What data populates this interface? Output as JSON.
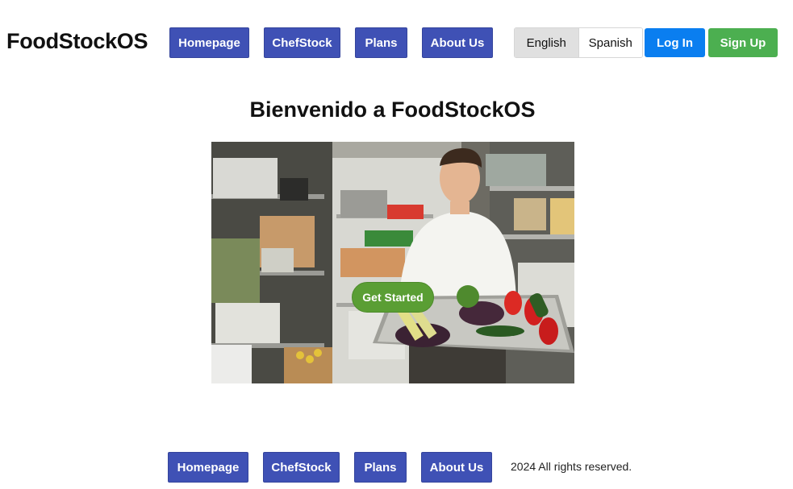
{
  "brand": {
    "name": "FoodStockOS"
  },
  "header_nav": {
    "items": [
      {
        "label": "Homepage"
      },
      {
        "label": "ChefStock"
      },
      {
        "label": "Plans"
      },
      {
        "label": "About Us"
      }
    ]
  },
  "language": {
    "english": "English",
    "spanish": "Spanish",
    "selected": "English"
  },
  "auth": {
    "login": "Log In",
    "signup": "Sign Up"
  },
  "hero": {
    "heading": "Bienvenido a FoodStockOS",
    "cta": "Get Started"
  },
  "footer_nav": {
    "items": [
      {
        "label": "Homepage"
      },
      {
        "label": "ChefStock"
      },
      {
        "label": "Plans"
      },
      {
        "label": "About Us"
      }
    ]
  },
  "footer": {
    "copyright": "2024 All rights reserved."
  },
  "colors": {
    "nav": "#3f51b5",
    "login": "#0a7ef0",
    "signup": "#4caf50",
    "cta": "#5a9e34"
  }
}
